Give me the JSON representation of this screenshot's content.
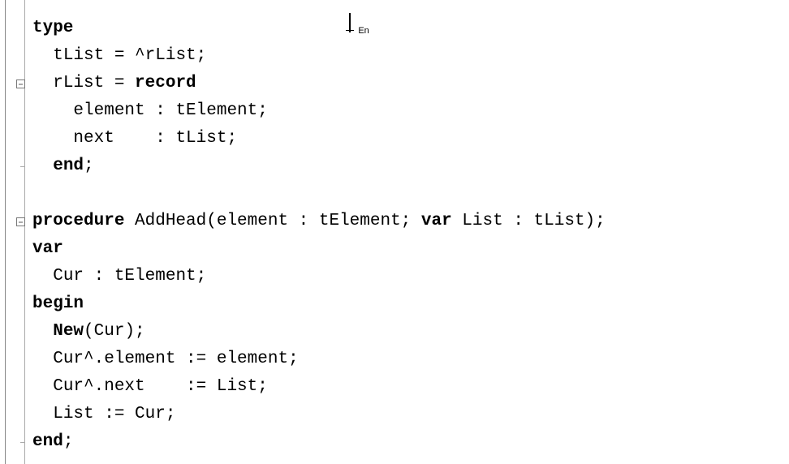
{
  "lang_indicator": "En",
  "code": {
    "lines": [
      {
        "indent": 0,
        "tokens": [
          {
            "t": "type",
            "kw": true
          }
        ]
      },
      {
        "indent": 1,
        "tokens": [
          {
            "t": "tList = ^rList;",
            "kw": false
          }
        ]
      },
      {
        "indent": 1,
        "tokens": [
          {
            "t": "rList = ",
            "kw": false
          },
          {
            "t": "record",
            "kw": true
          }
        ]
      },
      {
        "indent": 2,
        "tokens": [
          {
            "t": "element : tElement;",
            "kw": false
          }
        ]
      },
      {
        "indent": 2,
        "tokens": [
          {
            "t": "next    : tList;",
            "kw": false
          }
        ]
      },
      {
        "indent": 1,
        "tokens": [
          {
            "t": "end",
            "kw": true
          },
          {
            "t": ";",
            "kw": false
          }
        ]
      },
      {
        "indent": 0,
        "tokens": []
      },
      {
        "indent": 0,
        "tokens": [
          {
            "t": "procedure",
            "kw": true
          },
          {
            "t": " AddHead(element : tElement; ",
            "kw": false
          },
          {
            "t": "var",
            "kw": true
          },
          {
            "t": " List : tList);",
            "kw": false
          }
        ]
      },
      {
        "indent": 0,
        "tokens": [
          {
            "t": "var",
            "kw": true
          }
        ]
      },
      {
        "indent": 1,
        "tokens": [
          {
            "t": "Cur : tElement;",
            "kw": false
          }
        ]
      },
      {
        "indent": 0,
        "tokens": [
          {
            "t": "begin",
            "kw": true
          }
        ]
      },
      {
        "indent": 1,
        "tokens": [
          {
            "t": "New",
            "kw": true
          },
          {
            "t": "(Cur);",
            "kw": false
          }
        ]
      },
      {
        "indent": 1,
        "tokens": [
          {
            "t": "Cur^.element := element;",
            "kw": false
          }
        ]
      },
      {
        "indent": 1,
        "tokens": [
          {
            "t": "Cur^.next    := List;",
            "kw": false
          }
        ]
      },
      {
        "indent": 1,
        "tokens": [
          {
            "t": "List := Cur;",
            "kw": false
          }
        ]
      },
      {
        "indent": 0,
        "tokens": [
          {
            "t": "end",
            "kw": true
          },
          {
            "t": ";",
            "kw": false
          }
        ]
      }
    ]
  },
  "fold_markers": [
    {
      "line": 2,
      "type": "box"
    },
    {
      "line": 5,
      "type": "tick"
    },
    {
      "line": 7,
      "type": "box"
    },
    {
      "line": 15,
      "type": "tick"
    }
  ],
  "indent_spaces": "  "
}
